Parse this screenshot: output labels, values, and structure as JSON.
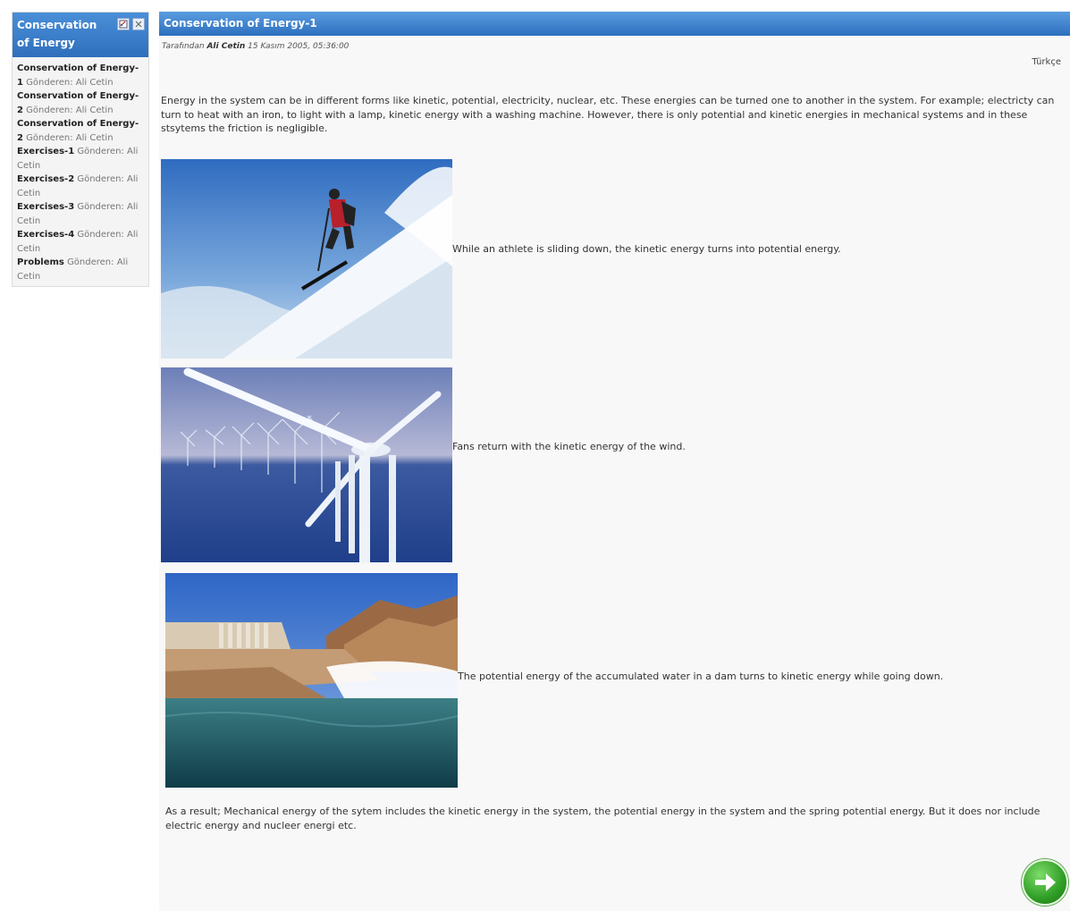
{
  "sidebar": {
    "title": "Conservation of Energy",
    "items": [
      {
        "title": "Conservation of Energy-1",
        "sender": "Gönderen: Ali Cetin"
      },
      {
        "title": "Conservation of Energy-2",
        "sender": "Gönderen: Ali Cetin"
      },
      {
        "title": "Conservation of Energy-2",
        "sender": "Gönderen: Ali Cetin"
      },
      {
        "title": "Exercises-1",
        "sender": "Gönderen: Ali Cetin"
      },
      {
        "title": "Exercises-2",
        "sender": "Gönderen: Ali Cetin"
      },
      {
        "title": "Exercises-3",
        "sender": "Gönderen: Ali Cetin"
      },
      {
        "title": "Exercises-4",
        "sender": "Gönderen: Ali Cetin"
      },
      {
        "title": "Problems",
        "sender": "Gönderen: Ali Cetin"
      }
    ]
  },
  "main": {
    "title": "Conservation of Energy-1",
    "byline_prefix": "Tarafından",
    "author": "Ali Cetin",
    "date": "15 Kasım 2005, 05:36:00",
    "language_link": "Türkçe",
    "intro": "Energy in the system can be in different forms like kinetic, potential, electricity, nuclear, etc. These energies can be turned one to another in the system. For example; electricty can turn to heat with an iron, to light with a lamp, kinetic energy with a washing machine. However, there is only potential and kinetic energies in mechanical systems and in these stsytems  the friction is negligible.",
    "figures": [
      {
        "caption": "While an athlete is sliding down,  the kinetic energy turns into potential energy."
      },
      {
        "caption": "Fans return with the kinetic energy of the wind."
      },
      {
        "caption": "The potential energy of the accumulated water in a dam turns to kinetic energy while going down."
      }
    ],
    "conclusion": " As a result; Mechanical energy of the sytem includes the kinetic energy in the system, the potential energy in the system and the spring potential energy. But  it does nor include electric energy and nucleer energi etc."
  },
  "icons": {
    "edit": "edit-icon",
    "close": "close-icon",
    "next": "next-arrow-icon"
  },
  "colors": {
    "header_blue": "#3a7fcf",
    "next_green": "#2f9e25"
  }
}
